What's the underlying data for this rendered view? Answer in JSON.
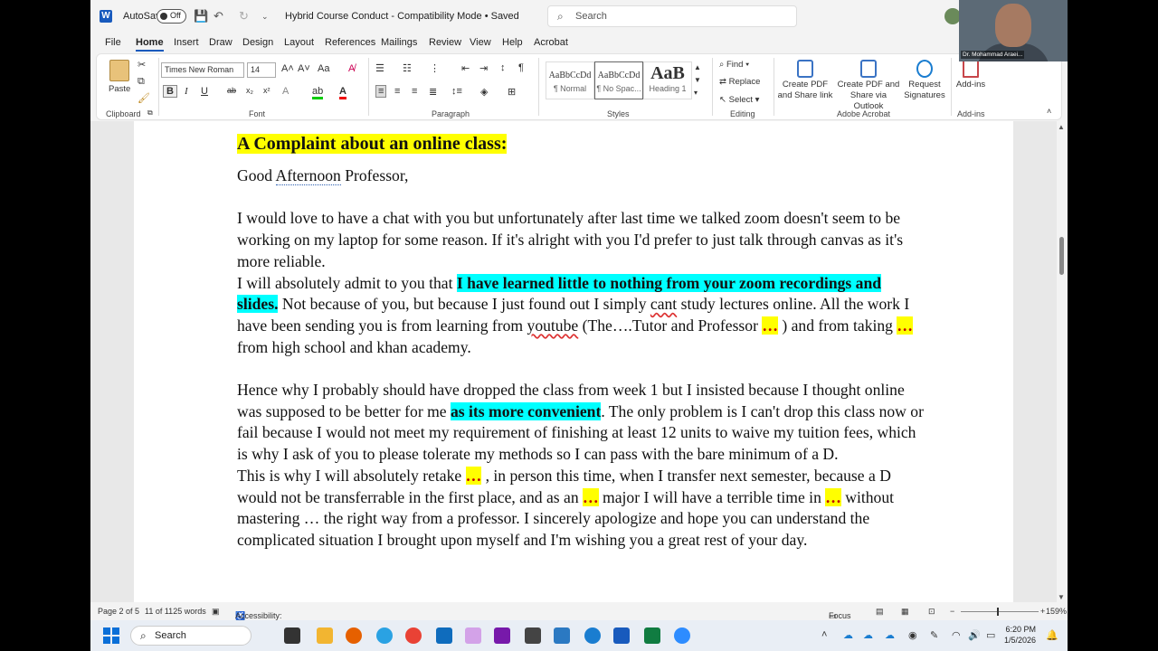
{
  "titlebar": {
    "autosave_label": "AutoSave",
    "autosave_state": "Off",
    "doc_title": "Hybrid Course Conduct  -  Compatibility Mode • Saved",
    "search_placeholder": "Search"
  },
  "tabs": [
    "File",
    "Home",
    "Insert",
    "Draw",
    "Design",
    "Layout",
    "References",
    "Mailings",
    "Review",
    "View",
    "Help",
    "Acrobat"
  ],
  "ribbon": {
    "clipboard": {
      "paste": "Paste",
      "label": "Clipboard"
    },
    "font": {
      "name": "Times New Roman",
      "size": "14",
      "label": "Font"
    },
    "paragraph": {
      "label": "Paragraph"
    },
    "styles": {
      "label": "Styles",
      "items": [
        {
          "preview": "AaBbCcDd",
          "name": "¶ Normal"
        },
        {
          "preview": "AaBbCcDd",
          "name": "¶ No Spac..."
        },
        {
          "preview": "AaB",
          "name": "Heading 1"
        }
      ]
    },
    "editing": {
      "find": "Find",
      "replace": "Replace",
      "select": "Select",
      "label": "Editing"
    },
    "acrobat": {
      "create_share": "Create PDF and Share link",
      "create_outlook": "Create PDF and Share via Outlook",
      "request_sig": "Request Signatures",
      "label": "Adobe Acrobat"
    },
    "addins": {
      "btn": "Add-ins",
      "label": "Add-ins"
    }
  },
  "document": {
    "heading": "A Complaint about an online class:",
    "greeting_a": "Good ",
    "greeting_b": "Afternoon",
    "greeting_c": " Professor,",
    "p1": "I would love to have a chat with you but unfortunately after last time we talked zoom doesn't seem to be working on my laptop for some reason. If it's alright with you I'd prefer to just talk through canvas as it's more reliable.",
    "p2_a": "I will absolutely admit to you that ",
    "p2_hl": "I have learned little to nothing from your zoom recordings and slides.",
    "p2_b": " Not because of you, but because I just found out I simply ",
    "p2_cant": "cant",
    "p2_c": " study lectures online. All the work I have been sending you is from learning from ",
    "p2_youtube": "youtube",
    "p2_d": " (The….Tutor and Professor ",
    "dots": "…",
    "p2_e": " ) and from taking ",
    "p2_f": " from high school and khan academy.",
    "p3_a": "Hence why I probably should have dropped the class from week 1 but I insisted because I thought online was supposed to be better for me ",
    "p3_hl": "as its more convenient",
    "p3_b": ". The only problem is I can't drop this class now or fail because I would not meet my requirement of finishing at least 12 units to waive my tuition fees, which is why I ask of you to please tolerate my methods so I can pass with the bare minimum of a D.",
    "p4_a": "This is why I will absolutely retake ",
    "p4_b": " , in person this time, when I transfer next semester, because a D would not be transferrable in the first place, and as an ",
    "p4_c": "  major I will have a terrible time in ",
    "p4_d": "  without mastering … the right way from a professor. I sincerely apologize and hope you can understand the complicated situation I brought upon myself and I'm wishing you a great rest of your day."
  },
  "status": {
    "page": "Page 2 of 5",
    "words": "11 of 1125 words",
    "accessibility": "Accessibility: Unavailable",
    "focus": "Focus",
    "zoom": "159%"
  },
  "webcam": {
    "name": "Dr. Mohammad Araei..."
  },
  "taskbar": {
    "search": "Search",
    "time": "6:20 PM",
    "date": "1/5/2026"
  }
}
